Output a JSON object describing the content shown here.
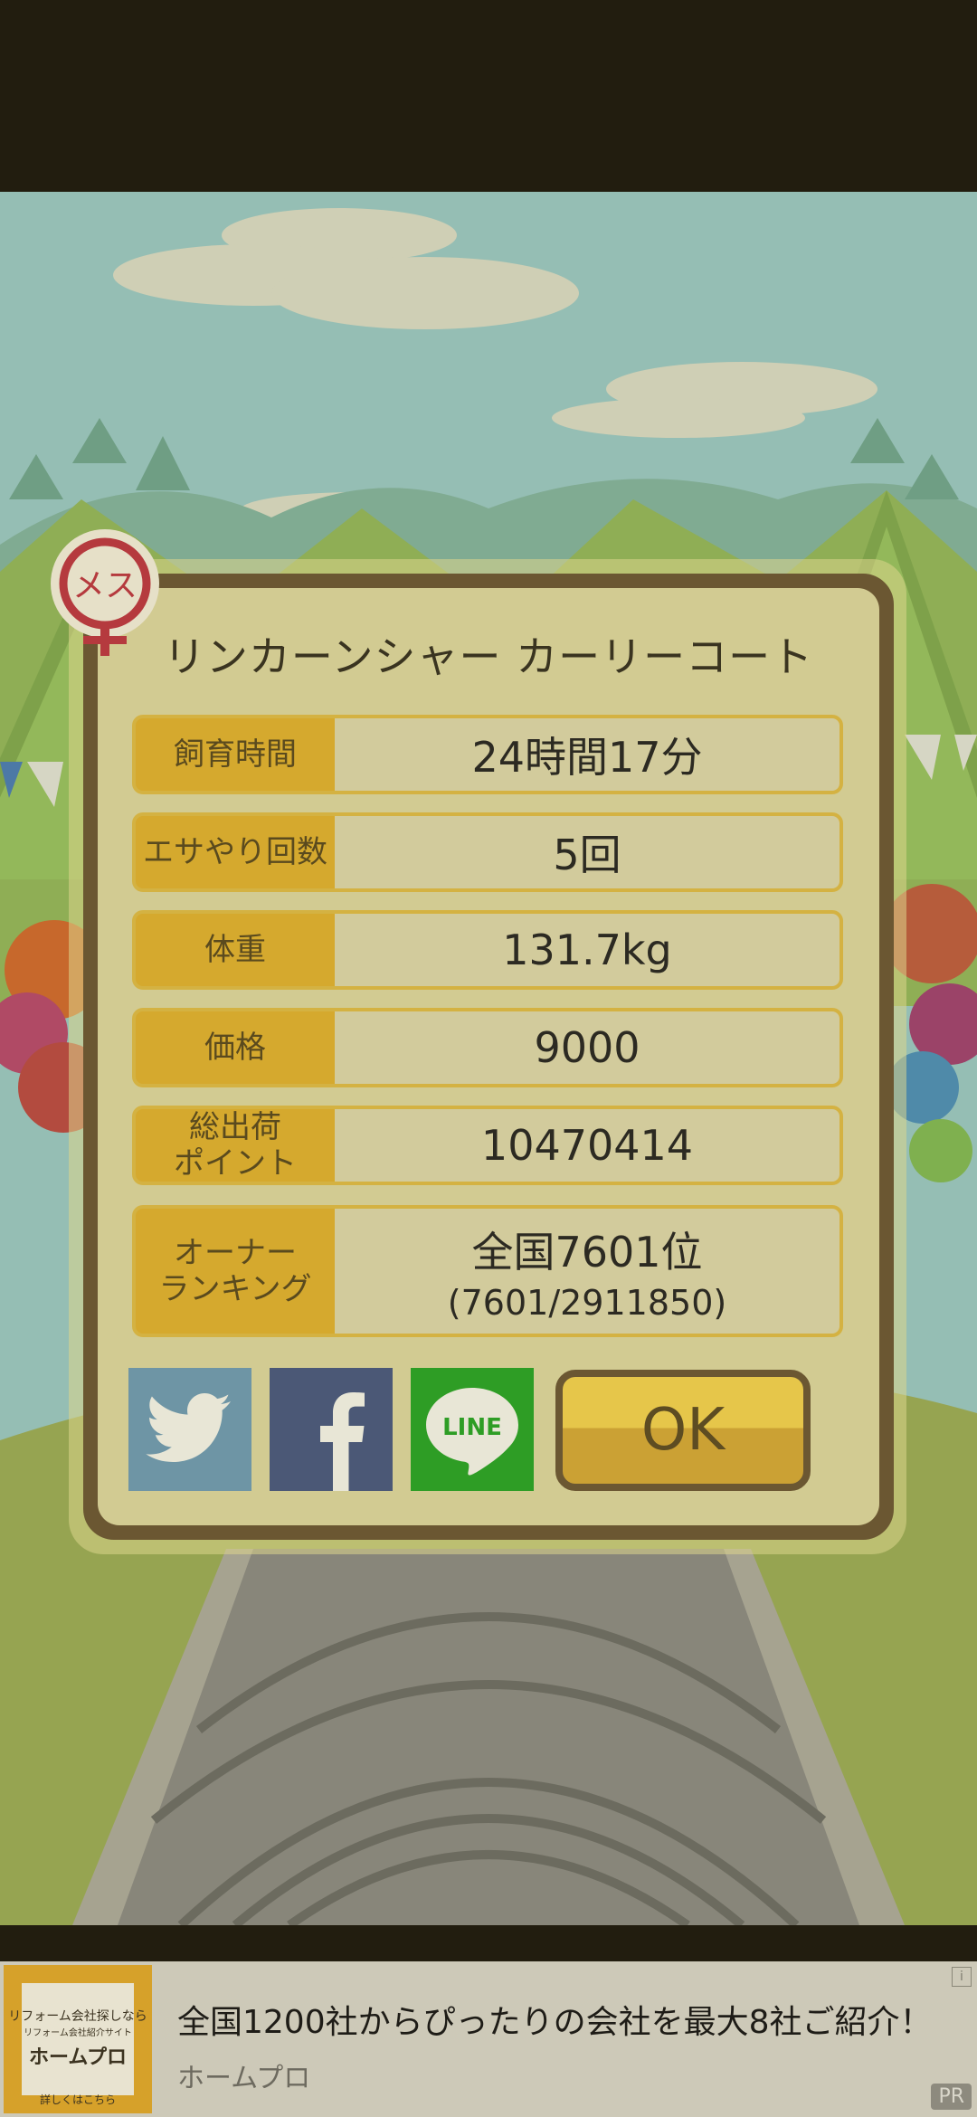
{
  "dialog": {
    "gender_badge": "メス",
    "title": "リンカーンシャー カーリーコート",
    "stats": [
      {
        "label": "飼育時間",
        "value": "24時間17分",
        "sub": ""
      },
      {
        "label": "エサやり回数",
        "value": "5回",
        "sub": ""
      },
      {
        "label": "体重",
        "value": "131.7kg",
        "sub": ""
      },
      {
        "label": "価格",
        "value": "9000",
        "sub": ""
      },
      {
        "label": "総出荷\nポイント",
        "value": "10470414",
        "sub": ""
      },
      {
        "label": "オーナー\nランキング",
        "value": "全国7601位",
        "sub": "(7601/2911850)"
      }
    ],
    "share": {
      "twitter_icon": "twitter-bird-icon",
      "facebook_icon": "facebook-f-icon",
      "line_label": "LINE"
    },
    "ok_label": "OK"
  },
  "ad": {
    "logo_tagline": "リフォーム会社探しなら",
    "logo_small": "リフォーム会社紹介サイト",
    "logo_brand": "ホームプロ",
    "logo_cta": "詳しくはこちら",
    "headline": "全国1200社からぴったりの会社を最大8社ご紹介！",
    "advertiser": "ホームプロ",
    "info_icon": "i",
    "pr_label": "PR"
  },
  "colors": {
    "dialog_frame": "#6b5732",
    "dialog_fill": "#d2cb92",
    "label_gold": "#d5a92e",
    "twitter": "#6e95a5",
    "facebook": "#4b5876",
    "line": "#2e9d25"
  }
}
